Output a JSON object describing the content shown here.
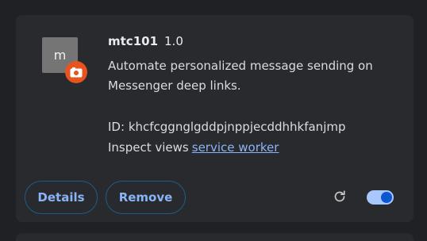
{
  "extension": {
    "icon_letter": "m",
    "name": "mtc101",
    "version": "1.0",
    "description": "Automate personalized message sending on Messenger deep links.",
    "id_label": "ID:",
    "id_value": "khcfcggnglgddpjnppjecddhhkfanjmp",
    "inspect_label": "Inspect views",
    "inspect_link": "service worker",
    "enabled": true
  },
  "actions": {
    "details_label": "Details",
    "remove_label": "Remove"
  },
  "colors": {
    "card_bg": "#292a2d",
    "page_bg": "#1f2124",
    "accent": "#8ab4f8",
    "badge": "#e8541d",
    "toggle_track": "#a8c7fa",
    "toggle_knob": "#0b57d0"
  },
  "icons": {
    "badge_icon": "unpacked-extension-icon",
    "reload_icon": "reload-icon"
  }
}
